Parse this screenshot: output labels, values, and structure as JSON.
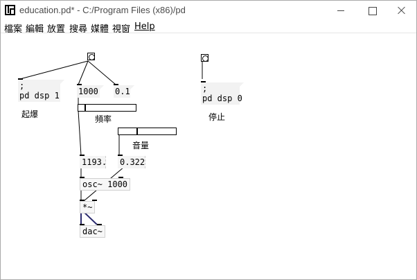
{
  "window": {
    "title": "education.pd* - C:/Program Files (x86)/pd"
  },
  "menu": {
    "items": [
      "檔案",
      "編輯",
      "放置",
      "搜尋",
      "媒體",
      "視窗",
      "Help"
    ]
  },
  "patch": {
    "msg_start": ";\npd dsp 1",
    "msg_stop": ";\npd dsp 0",
    "label_start": "起爆",
    "label_stop": "停止",
    "msg_1000": "1000",
    "msg_01": "0.1",
    "label_freq": "頻率",
    "label_volume": "音量",
    "num_freq": "1193.",
    "num_volume": "0.322",
    "obj_osc": "osc~ 1000",
    "obj_mul": "*~",
    "obj_dac": "dac~",
    "slider_freq_level": 0.11,
    "slider_volume_level": 0.32
  }
}
